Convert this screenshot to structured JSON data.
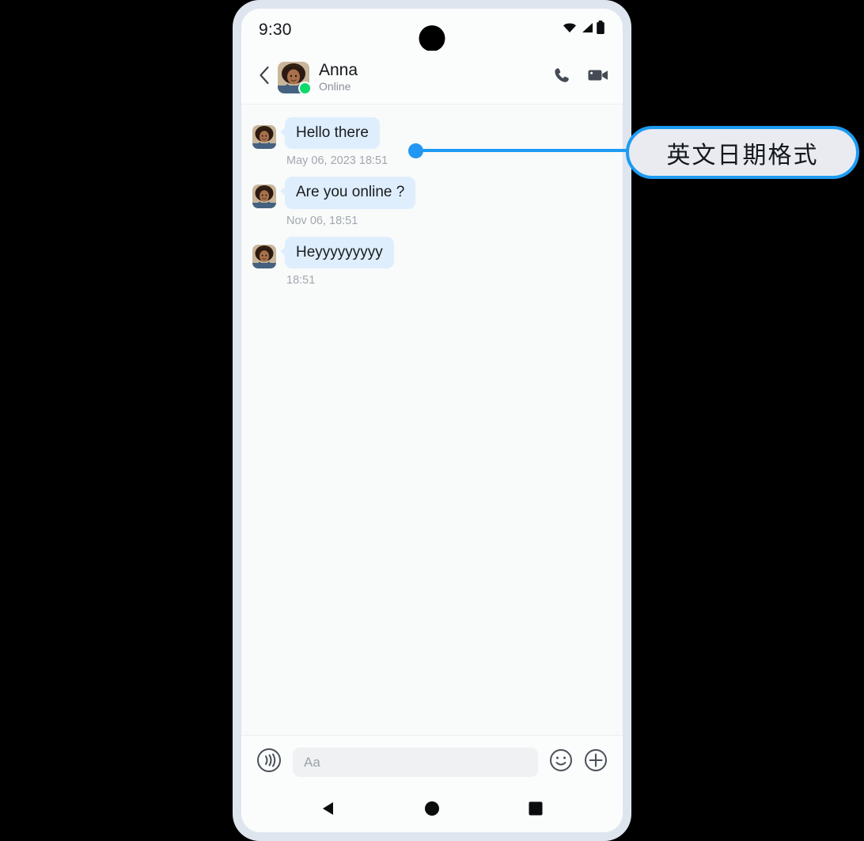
{
  "background_color": "#000000",
  "phone": {
    "frame_color": "#dfe5ee",
    "screen_color": "#fafbfb"
  },
  "status_bar": {
    "time": "9:30",
    "icons": [
      "wifi-icon",
      "cellular-signal-icon",
      "battery-icon"
    ],
    "camera_notch": "front-camera-punch-hole"
  },
  "chat_header": {
    "back_icon": "chevron-left-icon",
    "contact_name": "Anna",
    "presence": "Online",
    "presence_color": "#0ed96b",
    "avatar": "contact-avatar-photo",
    "actions": [
      {
        "name": "voice-call-button",
        "icon": "phone-icon"
      },
      {
        "name": "video-call-button",
        "icon": "video-camera-icon"
      }
    ]
  },
  "messages": [
    {
      "sender": "Anna",
      "text": "Hello there",
      "timestamp": "May 06, 2023 18:51",
      "side": "incoming",
      "bubble_color": "#dfeefc"
    },
    {
      "sender": "Anna",
      "text": "Are you online ?",
      "timestamp": "Nov 06, 18:51",
      "side": "incoming",
      "bubble_color": "#dfeefc"
    },
    {
      "sender": "Anna",
      "text": "Heyyyyyyyyy",
      "timestamp": "18:51",
      "side": "incoming",
      "bubble_color": "#dfeefc"
    }
  ],
  "composer": {
    "voice_icon": "voice-broadcast-icon",
    "input_value": "",
    "input_placeholder": "Aa",
    "emoji_icon": "smiley-face-icon",
    "attach_icon": "plus-circle-icon"
  },
  "nav_bar": {
    "back": "android-back-triangle-icon",
    "home": "android-home-circle-icon",
    "recents": "android-recents-square-icon"
  },
  "annotation": {
    "text": "英文日期格式",
    "line_color": "#1d9bf3",
    "dot_color": "#2196f3",
    "bubble_fill": "#e9ebf1",
    "bubble_border": "#1d9bf3"
  }
}
